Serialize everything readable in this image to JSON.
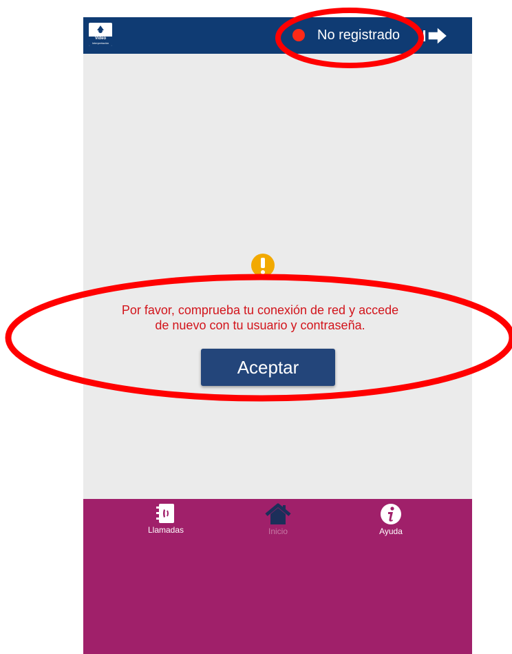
{
  "header": {
    "logo_text": "Video",
    "logo_subtext": "Interpretación",
    "status_text": "No registrado",
    "status_color": "#ff2a18",
    "exit_icon": "exit-arrow-icon",
    "background_color": "#0f3b73"
  },
  "dialog": {
    "icon": "warning-icon",
    "icon_color": "#f2a900",
    "message_line1": "Por favor, comprueba tu conexión de red y accede",
    "message_line2": "de nuevo con tu usuario y contraseña.",
    "message_color": "#d2141b",
    "accept_label": "Aceptar"
  },
  "tabbar": {
    "background_color": "#a0206a",
    "tabs": [
      {
        "label": "Llamadas",
        "icon": "phone-book-icon"
      },
      {
        "label": "Inicio",
        "icon": "home-icon"
      },
      {
        "label": "Ayuda",
        "icon": "info-icon"
      }
    ]
  },
  "annotations": {
    "color": "#ff0000"
  }
}
